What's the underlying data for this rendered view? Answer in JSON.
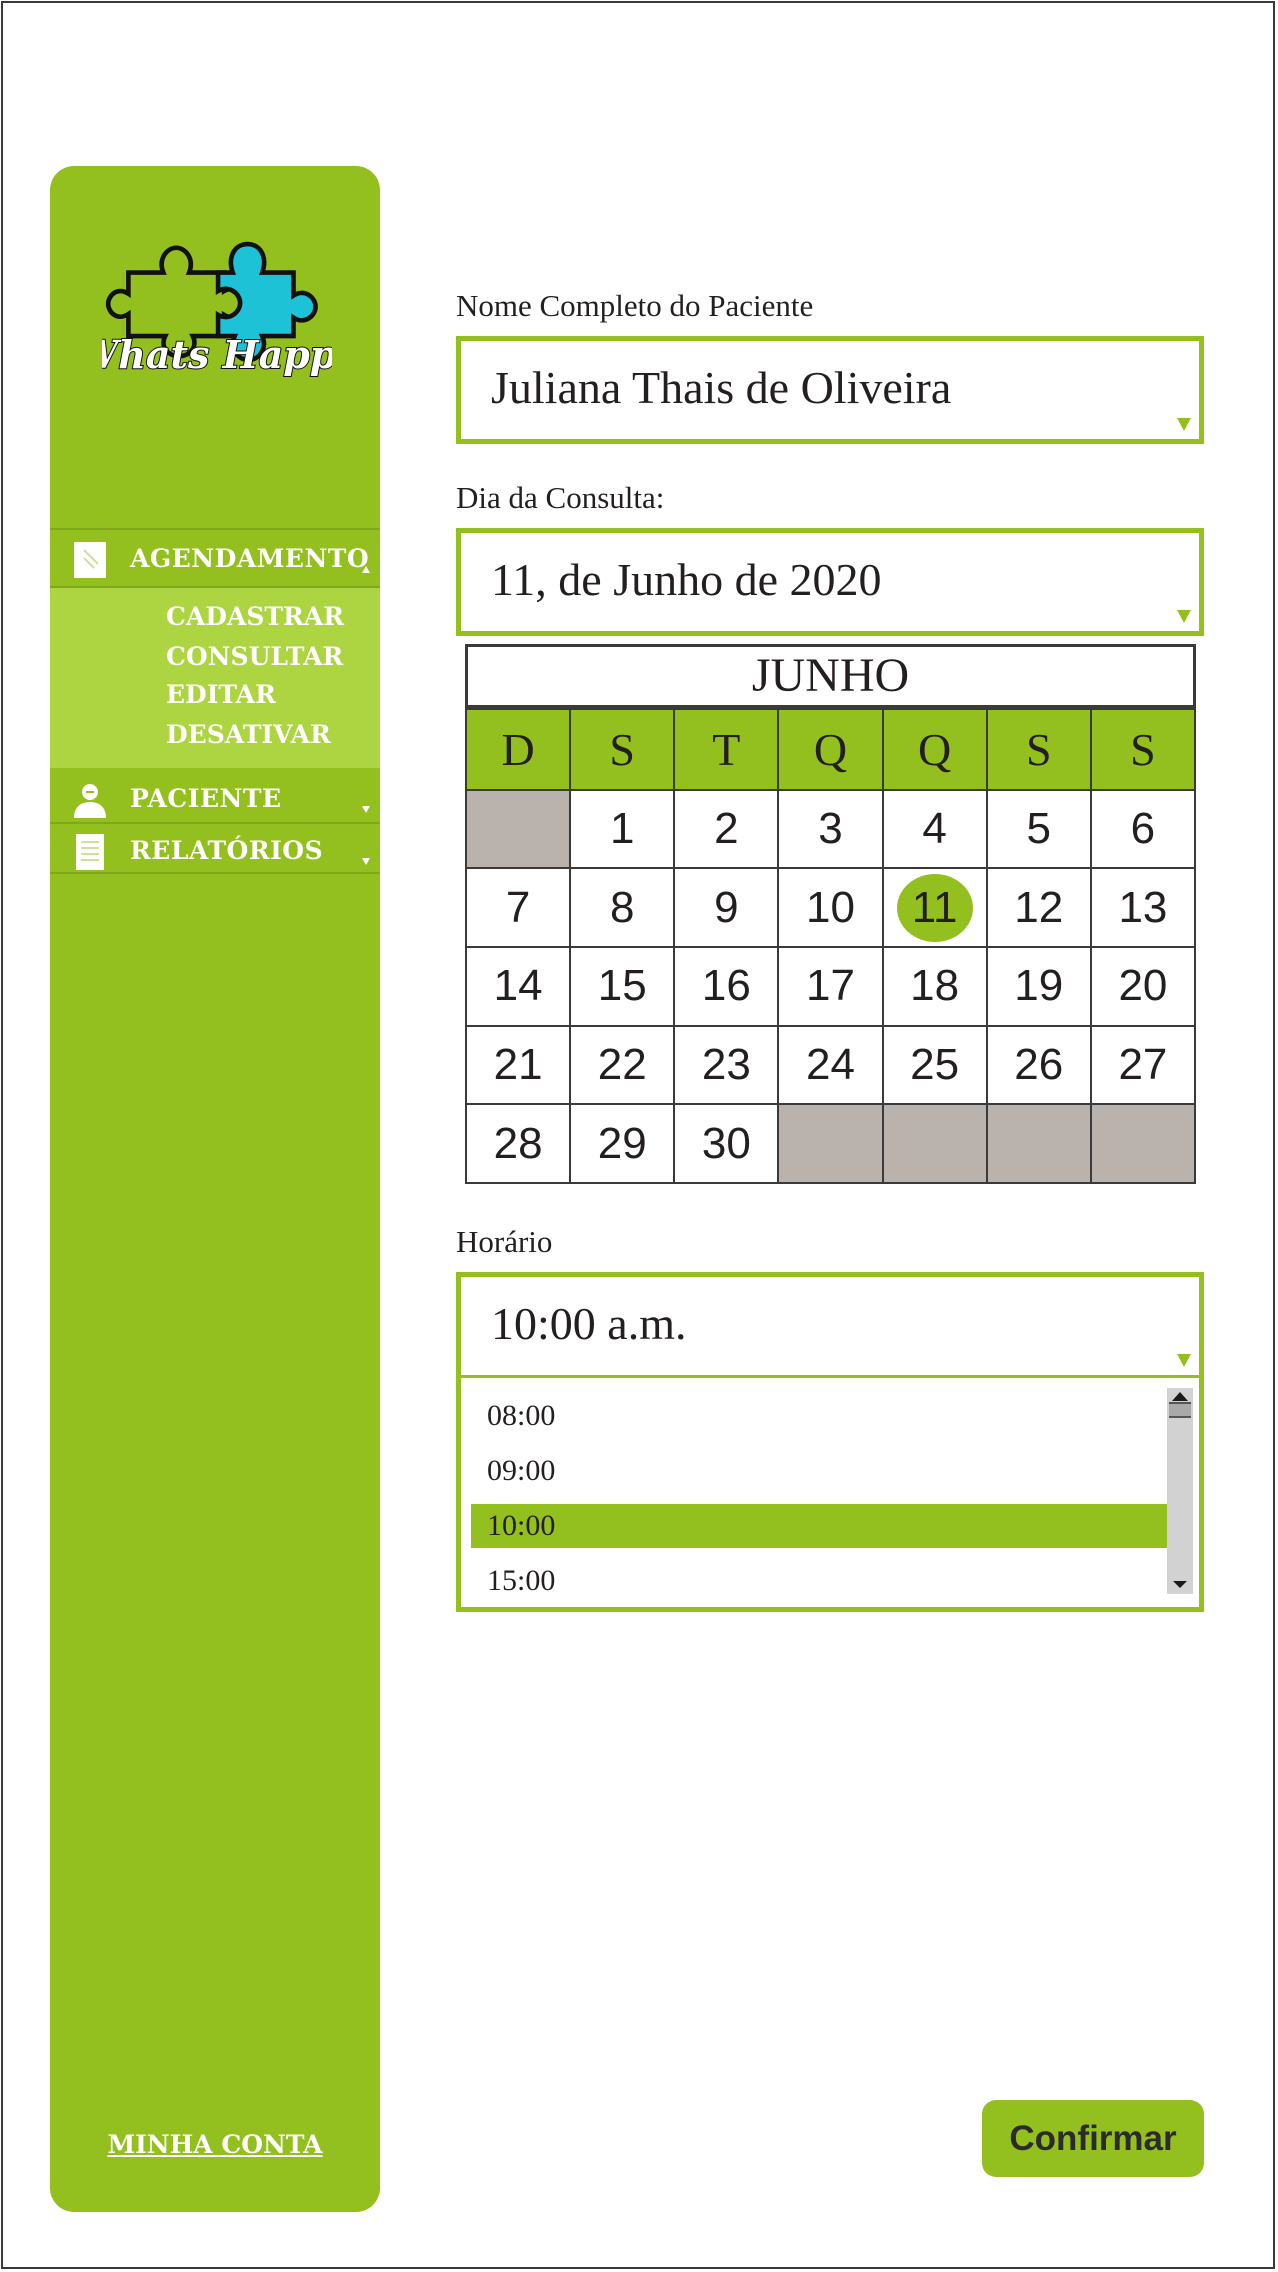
{
  "brand": {
    "name": "Whats Happy",
    "colors": {
      "accent": "#93c01f",
      "piece_blue": "#1ec2d6",
      "submenu": "#add441",
      "disabled_day": "#bab2ac"
    }
  },
  "sidebar": {
    "items": [
      {
        "label": "AGENDAMENTO",
        "icon": "calendar-icon"
      },
      {
        "label": "PACIENTE",
        "icon": "user-icon"
      },
      {
        "label": "RELATÓRIOS",
        "icon": "document-icon"
      }
    ],
    "submenu": [
      "CADASTRAR",
      "CONSULTAR",
      "EDITAR",
      "DESATIVAR"
    ],
    "account": "MINHA CONTA"
  },
  "form": {
    "patient": {
      "label": "Nome Completo do Paciente",
      "value": "Juliana Thais de Oliveira"
    },
    "date": {
      "label": "Dia da Consulta:",
      "value": "11, de Junho de 2020"
    },
    "time": {
      "label": "Horário",
      "value": "10:00 a.m."
    }
  },
  "calendar": {
    "month": "JUNHO",
    "weekdays": [
      "D",
      "S",
      "T",
      "Q",
      "Q",
      "S",
      "S"
    ],
    "weeks": [
      [
        "",
        "1",
        "2",
        "3",
        "4",
        "5",
        "6"
      ],
      [
        "7",
        "8",
        "9",
        "10",
        "11",
        "12",
        "13"
      ],
      [
        "14",
        "15",
        "16",
        "17",
        "18",
        "19",
        "20"
      ],
      [
        "21",
        "22",
        "23",
        "24",
        "25",
        "26",
        "27"
      ],
      [
        "28",
        "29",
        "30",
        "",
        "",
        "",
        ""
      ]
    ],
    "selected": "11"
  },
  "time_options": [
    "08:00",
    "09:00",
    "10:00",
    "15:00"
  ],
  "selected_time": "10:00",
  "confirm_label": "Confirmar"
}
